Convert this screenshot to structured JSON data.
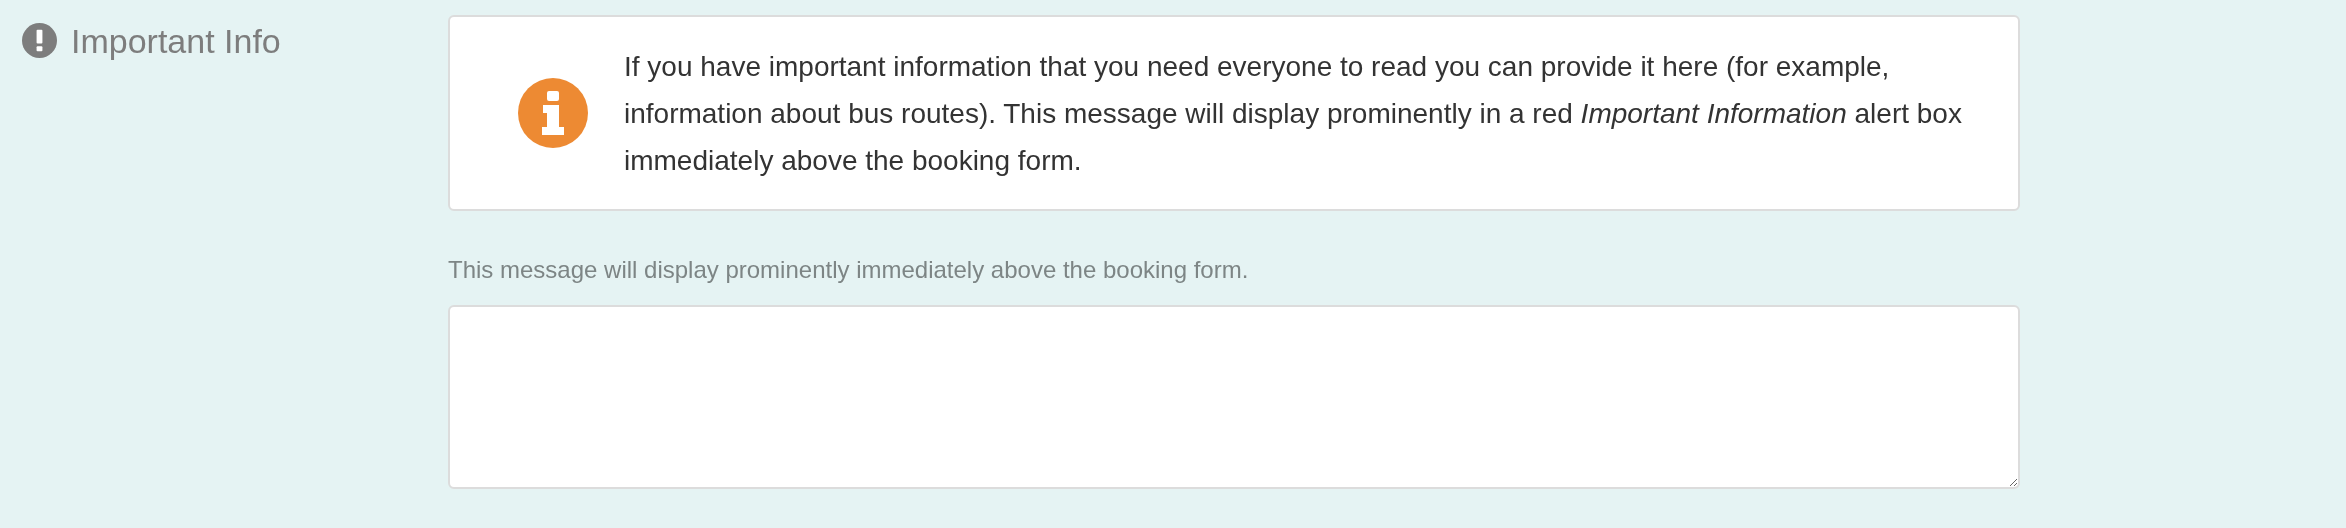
{
  "field": {
    "label": "Important Info",
    "alert": {
      "text": "If you have important information that you need everyone to read you can provide it here (for example, information about bus routes). This message will display prominently in a red *Important Information* alert box immediately above the booking form."
    },
    "help_text": "This message will display prominently immediately above the booking form."
  }
}
